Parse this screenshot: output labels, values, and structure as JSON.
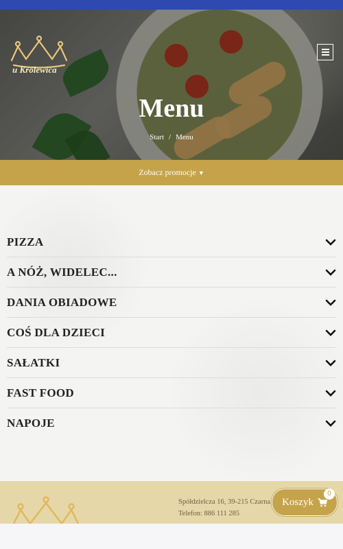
{
  "header": {
    "brand_name": "u Królewica",
    "page_title": "Menu",
    "breadcrumb": {
      "home": "Start",
      "separator": "/",
      "current": "Menu"
    }
  },
  "promo": {
    "label": "Zobacz promocje"
  },
  "categories": [
    {
      "label": "PIZZA"
    },
    {
      "label": "A NÓŻ, WIDELEC..."
    },
    {
      "label": "DANIA OBIADOWE"
    },
    {
      "label": "COŚ DLA DZIECI"
    },
    {
      "label": "SAŁATKI"
    },
    {
      "label": "FAST FOOD"
    },
    {
      "label": "NAPOJE"
    }
  ],
  "footer": {
    "address": "Spółdzielcza 16, 39-215 Czarna",
    "phone": "Telefon: 886 111 285"
  },
  "cart": {
    "label": "Koszyk",
    "count": "0"
  },
  "colors": {
    "accent": "#c5a34a",
    "topbar": "#2e49b0",
    "footer_bg": "#e6d7a8"
  },
  "icons": {
    "menu": "hamburger-icon",
    "chevron": "chevron-down-icon",
    "cart": "shopping-cart-icon",
    "logo": "crown-logo"
  }
}
